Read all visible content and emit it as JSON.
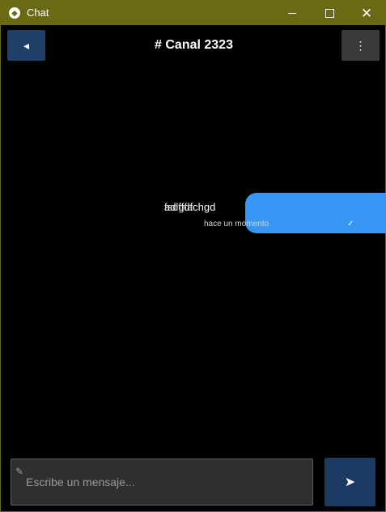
{
  "window": {
    "title": "Chat",
    "controls": {
      "minimize": "—",
      "maximize": "□",
      "close": "✕"
    }
  },
  "header": {
    "channel_title": "# Canal 2323",
    "back_icon": "back-arrow-icon",
    "menu_icon": "menu-icon"
  },
  "messages": [
    {
      "text_a": "adlffdfchgd",
      "text_b": "fsdgfa",
      "time": "hace un momento",
      "status_icon": "check-icon"
    }
  ],
  "composer": {
    "placeholder": "Escribe un mensaje...",
    "send_icon": "send-icon"
  },
  "colors": {
    "titlebar": "#6b6a14",
    "bubble": "#3896f5",
    "back_button": "#1e3f66",
    "send_button": "#1c3a61"
  }
}
